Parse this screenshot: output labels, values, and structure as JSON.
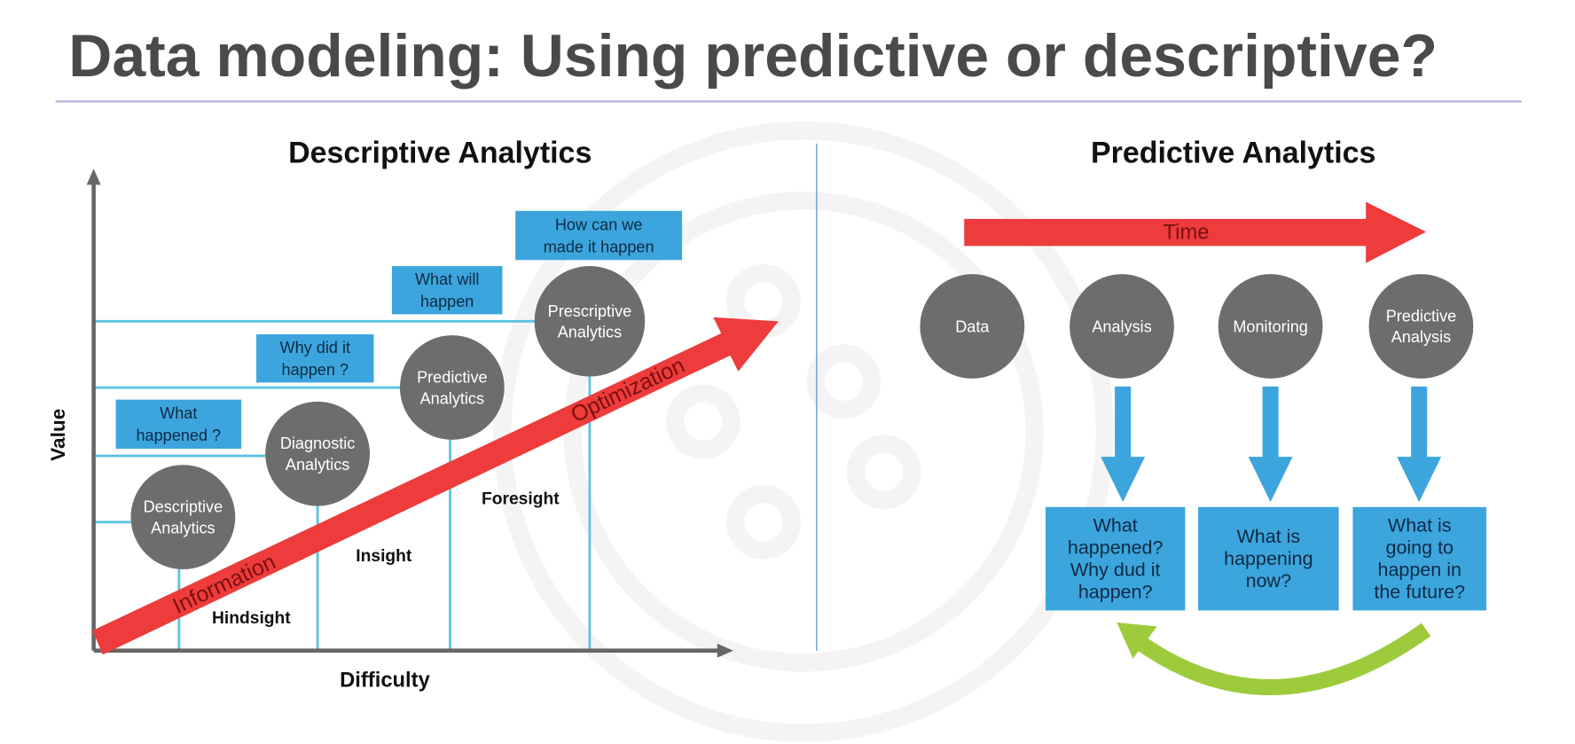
{
  "title": "Data modeling: Using predictive or descriptive?",
  "colors": {
    "accent_blue": "#3da5dd",
    "circle_gray": "#6d6d6d",
    "arrow_red": "#ee3b3b",
    "arrow_green": "#9dcb3b",
    "title_gray": "#4a4a4a",
    "grid_line": "#5bc3e0"
  },
  "descriptive": {
    "heading": "Descriptive Analytics",
    "y_axis_label": "Value",
    "x_axis_label": "Difficulty",
    "arrow_labels": [
      "Information",
      "Optimization"
    ],
    "circles": [
      {
        "line1": "Descriptive",
        "line2": "Analytics"
      },
      {
        "line1": "Diagnostic",
        "line2": "Analytics"
      },
      {
        "line1": "Predictive",
        "line2": "Analytics"
      },
      {
        "line1": "Prescriptive",
        "line2": "Analytics"
      }
    ],
    "questions": [
      {
        "line1": "What",
        "line2": "happened ?"
      },
      {
        "line1": "Why did it",
        "line2": "happen ?"
      },
      {
        "line1": "What will",
        "line2": "happen"
      },
      {
        "line1": "How can we",
        "line2": "made it happen"
      }
    ],
    "stages": [
      "Hindsight",
      "Insight",
      "Foresight"
    ]
  },
  "predictive": {
    "heading": "Predictive Analytics",
    "time_label": "Time",
    "circles": [
      {
        "line1": "Data",
        "line2": ""
      },
      {
        "line1": "Analysis",
        "line2": ""
      },
      {
        "line1": "Monitoring",
        "line2": ""
      },
      {
        "line1": "Predictive",
        "line2": "Analysis"
      }
    ],
    "boxes": [
      {
        "lines": [
          "What",
          "happened?",
          "Why dud it",
          "happen?"
        ]
      },
      {
        "lines": [
          "What is",
          "happening",
          "now?"
        ]
      },
      {
        "lines": [
          "What is",
          "going to",
          "happen in",
          "the future?"
        ]
      }
    ]
  }
}
